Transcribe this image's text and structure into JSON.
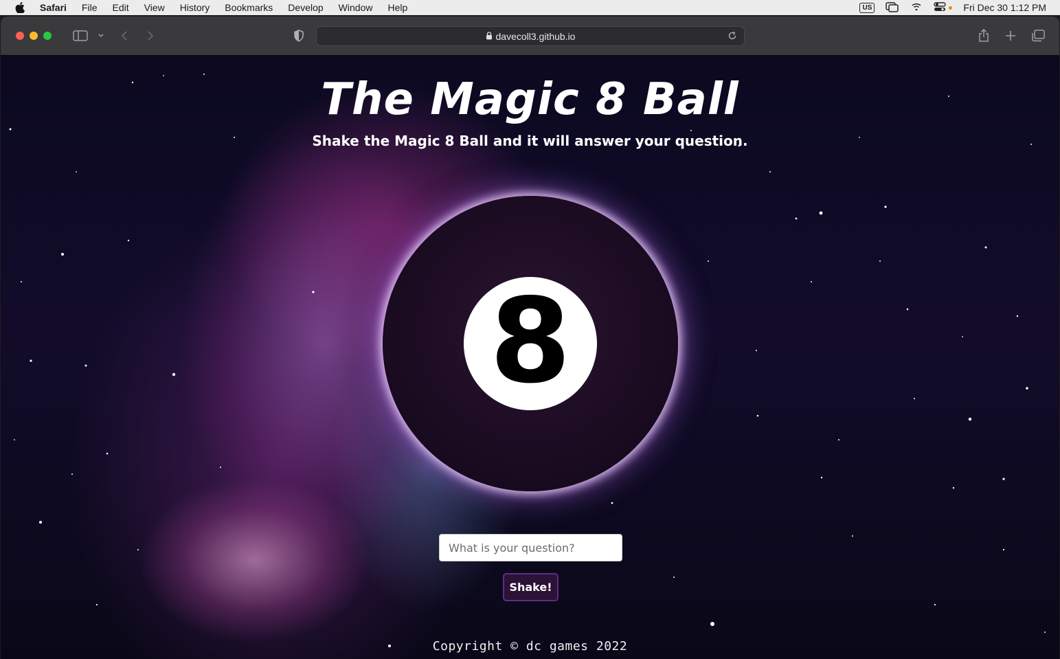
{
  "menubar": {
    "app_name": "Safari",
    "items": [
      "File",
      "Edit",
      "View",
      "History",
      "Bookmarks",
      "Develop",
      "Window",
      "Help"
    ],
    "input_source": "US",
    "datetime": "Fri Dec 30  1:12 PM"
  },
  "browser": {
    "url": "davecoll3.github.io"
  },
  "page": {
    "title": "The Magic 8 Ball",
    "subtitle": "Shake the Magic 8 Ball and it will answer your question.",
    "ball_number": "8",
    "question_placeholder": "What is your question?",
    "question_value": "",
    "shake_label": "Shake!",
    "copyright": "Copyright © dc games 2022"
  }
}
